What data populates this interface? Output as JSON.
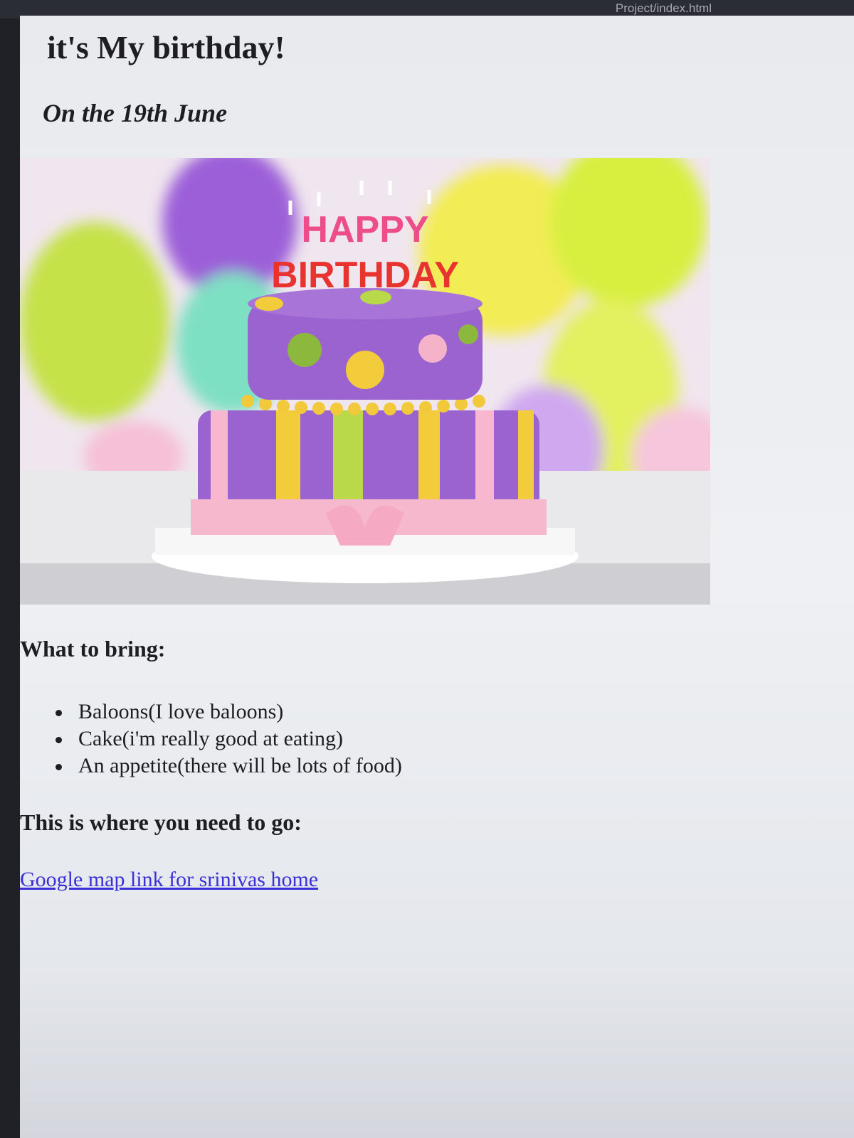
{
  "browser": {
    "url_text": "Project/index.html"
  },
  "page": {
    "title": "it's My birthday!",
    "subtitle": "On the 19th June",
    "hero_image": {
      "cake_text_line1": "HAPPY",
      "cake_text_line2": "BIRTHDAY"
    },
    "bring_heading": "What to bring:",
    "bring_items": [
      "Baloons(I love baloons)",
      "Cake(i'm really good at eating)",
      "An appetite(there will be lots of food)"
    ],
    "where_heading": "This is where you need to go:",
    "map_link_text": "Google map link for srinivas home"
  }
}
